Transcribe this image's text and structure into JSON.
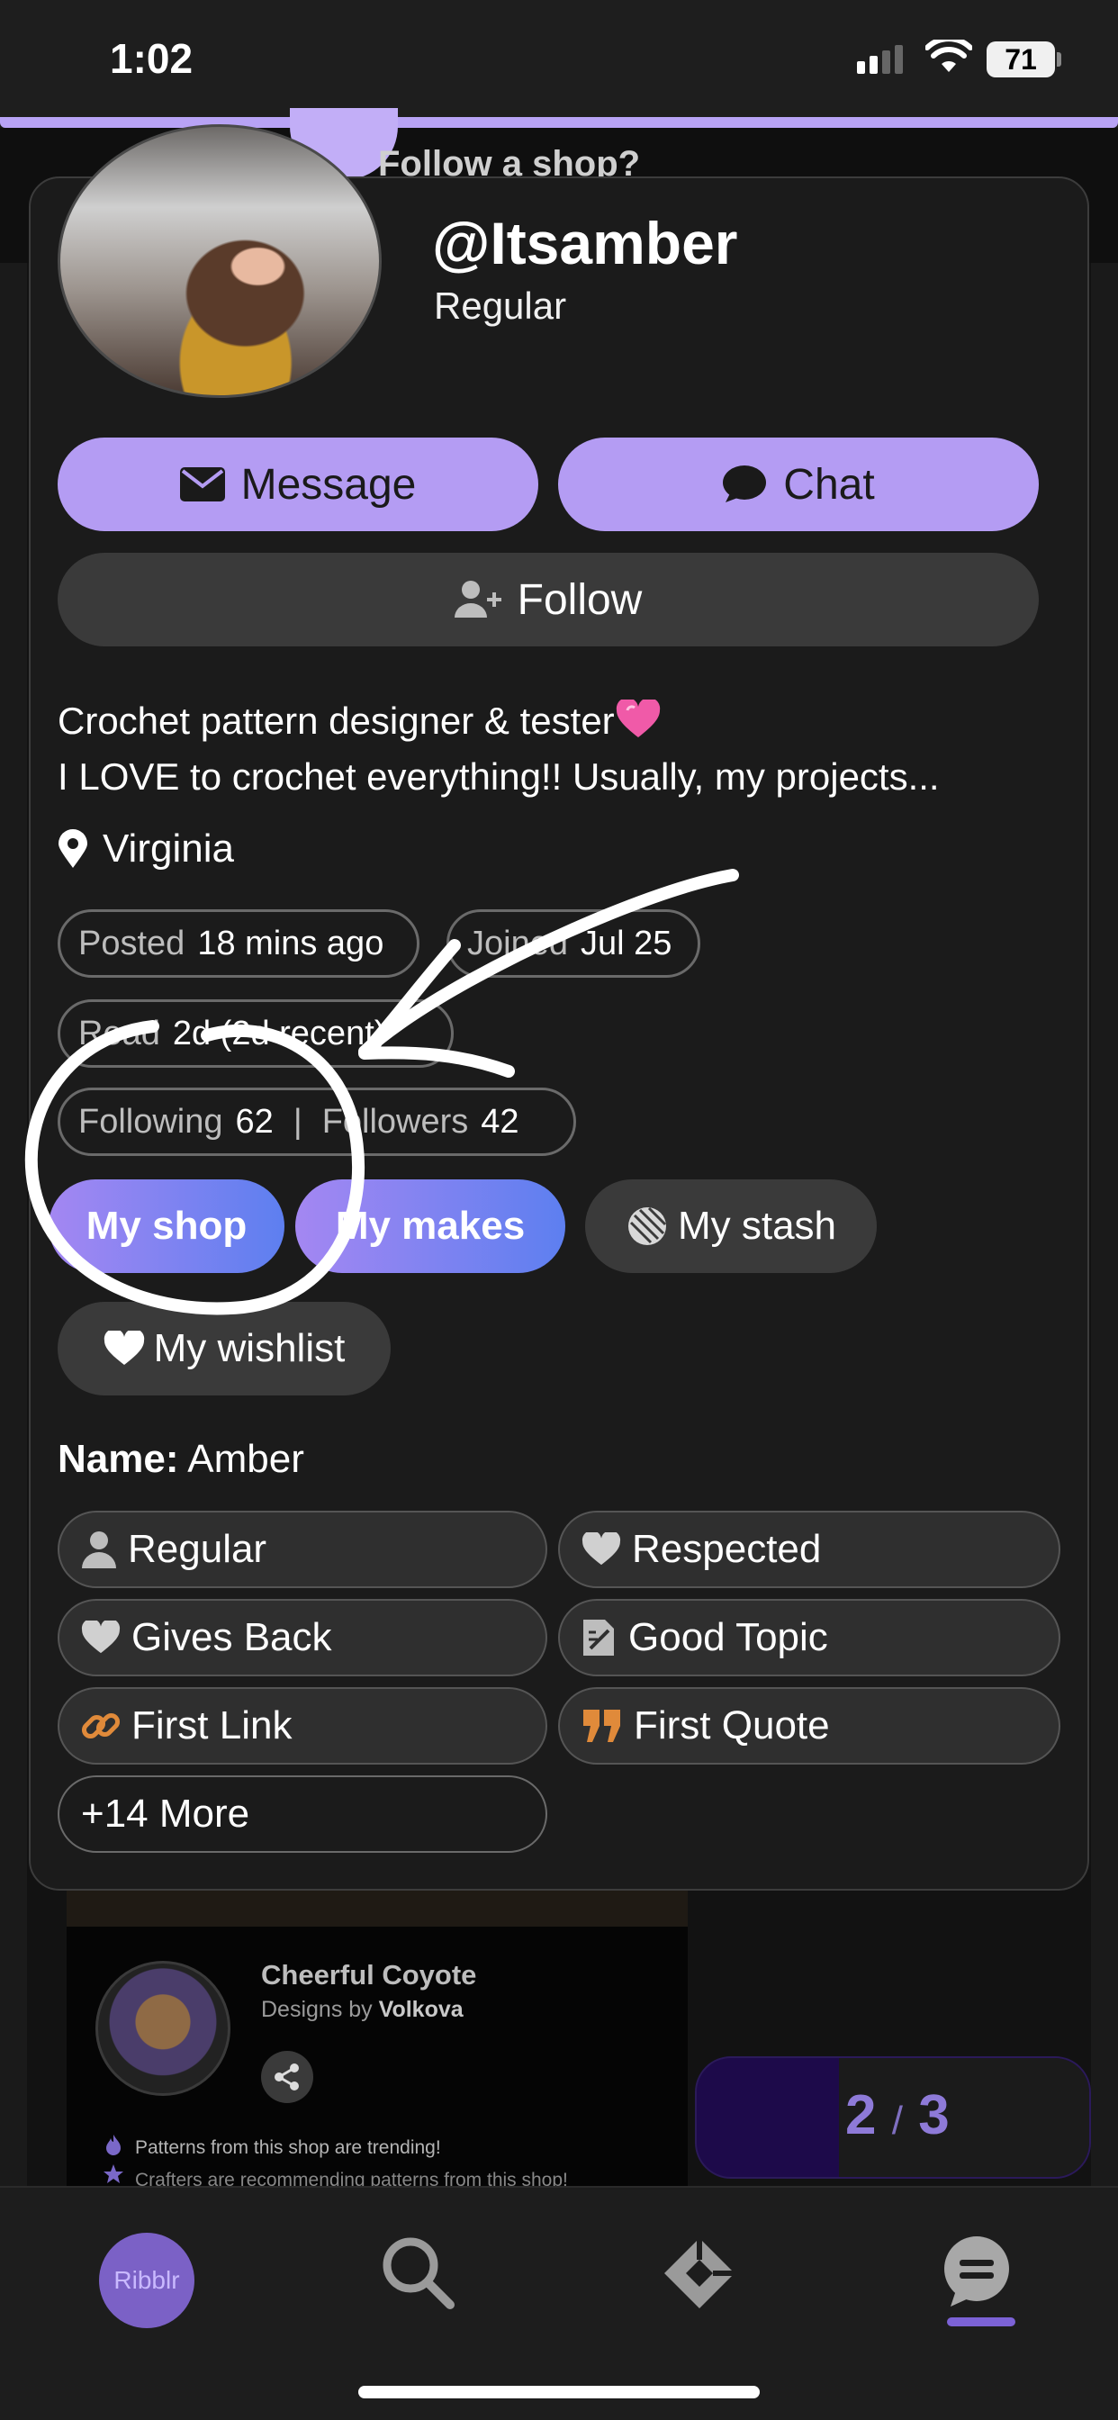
{
  "status_bar": {
    "time": "1:02",
    "battery": "71"
  },
  "background": {
    "header_text": "Follow a shop?",
    "shop": {
      "name": "Cheerful Coyote",
      "designer_prefix": "Designs by",
      "designer": "Volkova",
      "note_trending": "Patterns from this shop are trending!",
      "note_recommend": "Crafters are recommending patterns from this shop!"
    },
    "pager": {
      "current": "2",
      "separator": "/",
      "total": "3"
    }
  },
  "bottom_nav": {
    "avatar_label": "Ribblr",
    "items": [
      "home-avatar",
      "search-icon",
      "patterns-icon",
      "chat-icon"
    ]
  },
  "profile": {
    "username": "@Itsamber",
    "rank": "Regular",
    "buttons": {
      "message": "Message",
      "chat": "Chat",
      "follow": "Follow"
    },
    "bio_line1": "Crochet pattern designer & tester",
    "bio_line2": "I LOVE to crochet everything!! Usually, my projects...",
    "location": "Virginia",
    "stats": {
      "posted_label": "Posted",
      "posted_value": "18 mins ago",
      "joined_label": "Joined",
      "joined_value": "Jul 25",
      "read_label": "Read",
      "read_value": "2d (2d recent)",
      "following_label": "Following",
      "following_value": "62",
      "followers_label": "Followers",
      "followers_value": "42"
    },
    "tabs": {
      "shop": "My shop",
      "makes": "My makes",
      "stash": "My stash",
      "wishlist": "My wishlist"
    },
    "name_label": "Name:",
    "name_value": "Amber",
    "badges": {
      "regular": "Regular",
      "respected": "Respected",
      "gives_back": "Gives Back",
      "good_topic": "Good Topic",
      "first_link": "First Link",
      "first_quote": "First Quote",
      "more": "+14 More"
    }
  },
  "colors": {
    "accent": "#b49cf3",
    "gradient_start": "#a487f2",
    "gradient_end": "#5d7ff0",
    "background": "#1b1b1b"
  }
}
